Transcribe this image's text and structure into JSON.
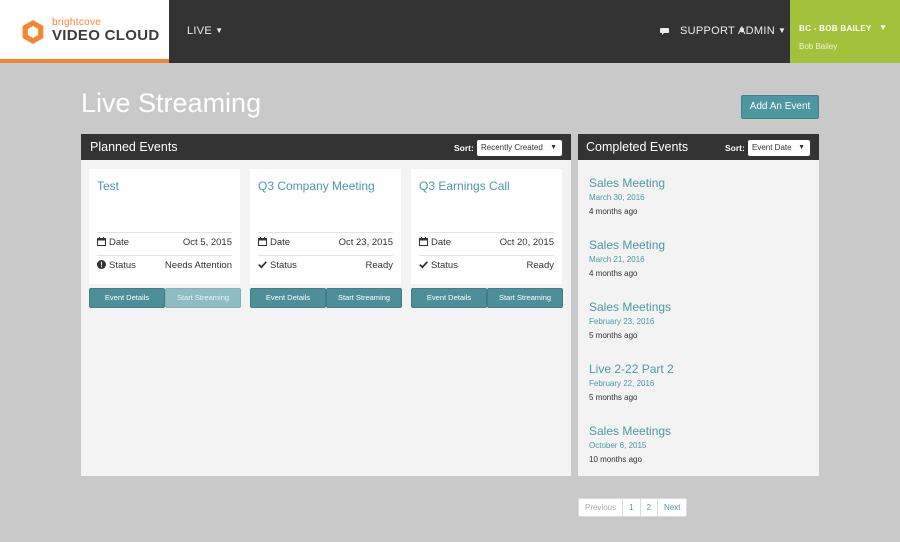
{
  "brand": {
    "small": "brightcove",
    "big": "VIDEO CLOUD",
    "accent": "#f58534"
  },
  "nav": {
    "live": "LIVE",
    "chat_icon": "chat-bubble-icon",
    "support": "SUPPORT",
    "admin": "ADMIN",
    "caret": "▼"
  },
  "user": {
    "account": "BC - BOB BAILEY",
    "name": "Bob Bailey",
    "color": "#a3c23b"
  },
  "page": {
    "title": "Live Streaming",
    "add_label": "Add An Event"
  },
  "planned": {
    "title": "Planned Events",
    "sort_label": "Sort:",
    "sort_value": "Recently Created",
    "events": [
      {
        "name": "Test",
        "date_label": "Date",
        "date": "Oct 5, 2015",
        "status_label": "Status",
        "status": "Needs Attention",
        "status_icon": "exclamation-circle-icon",
        "details": "Event Details",
        "stream": "Start Streaming",
        "stream_enabled": false
      },
      {
        "name": "Q3 Company Meeting",
        "date_label": "Date",
        "date": "Oct 23, 2015",
        "status_label": "Status",
        "status": "Ready",
        "status_icon": "check-icon",
        "details": "Event Details",
        "stream": "Start Streaming",
        "stream_enabled": true
      },
      {
        "name": "Q3 Earnings Call",
        "date_label": "Date",
        "date": "Oct 20, 2015",
        "status_label": "Status",
        "status": "Ready",
        "status_icon": "check-icon",
        "details": "Event Details",
        "stream": "Start Streaming",
        "stream_enabled": true
      }
    ]
  },
  "completed": {
    "title": "Completed Events",
    "sort_label": "Sort:",
    "sort_value": "Event Date",
    "events": [
      {
        "name": "Sales Meeting",
        "date": "March 30, 2016",
        "ago": "4 months ago"
      },
      {
        "name": "Sales Meeting",
        "date": "March 21, 2016",
        "ago": "4 months ago"
      },
      {
        "name": "Sales Meetings",
        "date": "February 23, 2016",
        "ago": "5 months ago"
      },
      {
        "name": "Live 2-22 Part 2",
        "date": "February 22, 2016",
        "ago": "5 months ago"
      },
      {
        "name": "Sales Meetings",
        "date": "October 6, 2015",
        "ago": "10 months ago"
      }
    ]
  },
  "pagination": {
    "previous": "Previous",
    "pages": [
      "1",
      "2"
    ],
    "next": "Next"
  }
}
